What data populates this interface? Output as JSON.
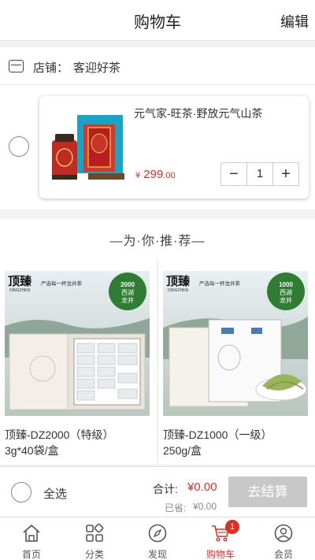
{
  "header": {
    "title": "购物车",
    "edit_label": "编辑"
  },
  "shop": {
    "label": "店铺：",
    "name": "客迎好茶"
  },
  "cart_item": {
    "name": "元气家-旺茶·野放元气山茶",
    "currency": "¥",
    "price_int": "299",
    "price_dec": ".00",
    "quantity": "1",
    "minus": "−",
    "plus": "+"
  },
  "recommend": {
    "heading": "—为·你·推·荐—"
  },
  "products": [
    {
      "line1": "顶臻-DZ2000（特级）",
      "line2": "3g*40袋/盒",
      "brand": "顶臻",
      "slogan": "严选每一杯龙井茶",
      "badge_num": "2000",
      "badge_text1": "西湖",
      "badge_text2": "龙井",
      "brand_en": "DINGZHEN"
    },
    {
      "line1": "顶臻-DZ1000（一级）",
      "line2": "250g/盒",
      "brand": "顶臻",
      "slogan": "严选每一杯龙井茶",
      "badge_num": "1000",
      "badge_text1": "西湖",
      "badge_text2": "龙井",
      "brand_en": "DINGZHEN"
    }
  ],
  "checkout": {
    "select_all": "全选",
    "total_label": "合计:",
    "total": "¥0.00",
    "saved_label": "已省:",
    "saved": "¥0.00",
    "pay_label": "去结算"
  },
  "tabs": [
    {
      "label": "首页",
      "icon": "home-icon"
    },
    {
      "label": "分类",
      "icon": "category-icon"
    },
    {
      "label": "发现",
      "icon": "compass-icon"
    },
    {
      "label": "购物车",
      "icon": "cart-icon",
      "badge": "1"
    },
    {
      "label": "会员",
      "icon": "user-icon"
    }
  ],
  "colors": {
    "accent": "#e02e24",
    "badge_green": "#2e7d32",
    "disabled": "#c8c8c8"
  }
}
